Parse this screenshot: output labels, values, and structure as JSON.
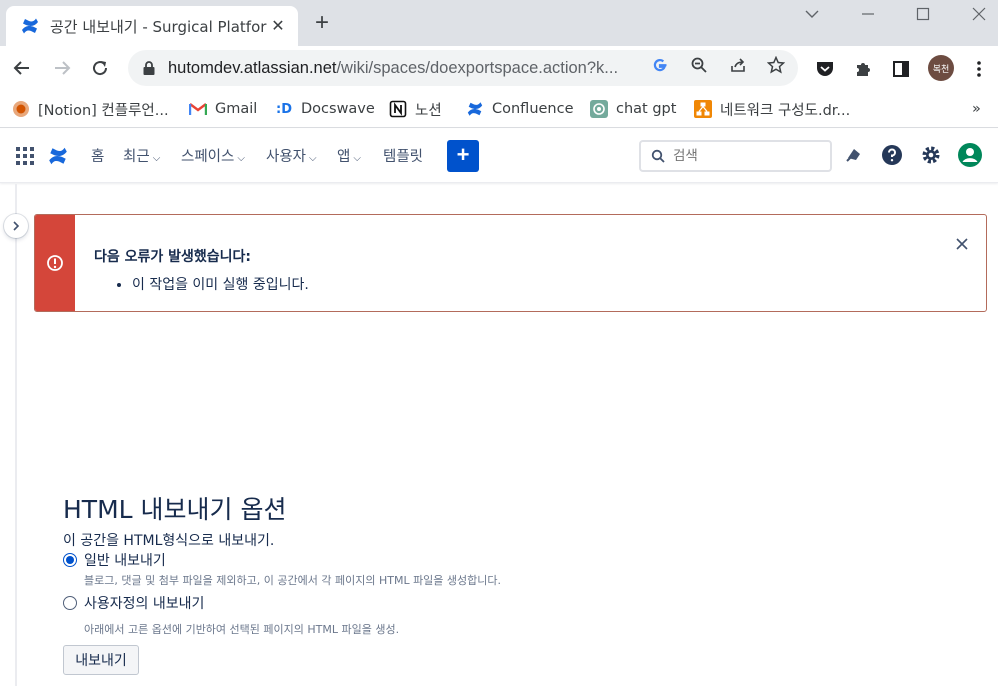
{
  "browser": {
    "tab_title": "공간 내보내기 - Surgical Platfor",
    "url_host": "hutomdev.atlassian.net",
    "url_path": "/wiki/spaces/doexportspace.action?k...",
    "profile_label": "복천"
  },
  "bookmarks": [
    {
      "label": "[Notion] 컨플루언...",
      "icon": "notion-icon"
    },
    {
      "label": "Gmail",
      "icon": "gmail-icon"
    },
    {
      "label": "Docswave",
      "icon": "docswave-icon"
    },
    {
      "label": "노션",
      "icon": "notion-icon"
    },
    {
      "label": "Confluence",
      "icon": "confluence-icon"
    },
    {
      "label": "chat gpt",
      "icon": "chatgpt-icon"
    },
    {
      "label": "네트워크 구성도.dr...",
      "icon": "drawio-icon"
    }
  ],
  "bookmarks_more": "»",
  "confluence_nav": {
    "home": "홈",
    "recent": "최근",
    "spaces": "스페이스",
    "people": "사용자",
    "apps": "앱",
    "templates": "템플릿",
    "create": "+",
    "search_placeholder": "검색"
  },
  "error": {
    "heading": "다음 오류가 발생했습니다:",
    "items": [
      "이 작업을 이미 실행 중입니다."
    ]
  },
  "export": {
    "title": "HTML 내보내기 옵션",
    "description": "이 공간을 HTML형식으로 내보내기.",
    "options": [
      {
        "label": "일반 내보내기",
        "sub": "블로그, 댓글 및 첨부 파일을 제외하고, 이 공간에서 각 페이지의 HTML 파일을 생성합니다.",
        "selected": true
      },
      {
        "label": "사용자정의 내보내기",
        "sub": "아래에서 고른 옵션에 기반하여 선택된 페이지의 HTML 파일을 생성.",
        "selected": false
      }
    ],
    "button": "내보내기"
  },
  "colors": {
    "confluence_blue": "#0052cc",
    "error_red": "#d4463a",
    "profile_green": "#00875a"
  }
}
